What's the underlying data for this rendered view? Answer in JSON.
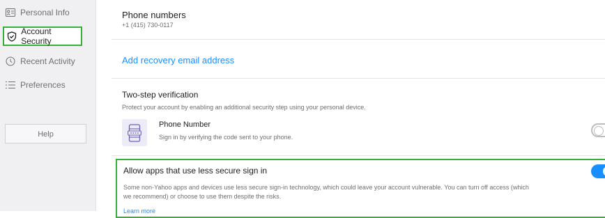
{
  "sidebar": {
    "items": [
      {
        "label": "Personal Info",
        "icon": "id-card-icon"
      },
      {
        "label": "Account Security",
        "icon": "shield-icon"
      },
      {
        "label": "Recent Activity",
        "icon": "clock-icon"
      },
      {
        "label": "Preferences",
        "icon": "list-icon"
      }
    ],
    "active_index": 1,
    "help_label": "Help"
  },
  "main": {
    "phone": {
      "title": "Phone numbers",
      "value": "+1 (415) 730-0117"
    },
    "recovery": {
      "link_label": "Add recovery email address"
    },
    "two_step": {
      "title": "Two-step verification",
      "description": "Protect your account by enabling an additional security step using your personal device.",
      "method": {
        "label": "Phone Number",
        "description": "Sign in by verifying the code sent to your phone.",
        "icon": "phone-code-icon",
        "enabled": false
      }
    },
    "less_secure": {
      "title": "Allow apps that use less secure sign in",
      "description": "Some non-Yahoo apps and devices use less secure sign-in technology, which could leave your account vulnerable. You can turn off access (which we recommend) or choose to use them despite the risks.",
      "learn_more": "Learn more",
      "enabled": true
    }
  },
  "colors": {
    "accent": "#188fff",
    "highlight_border": "#36b037",
    "icon_tile": "#ecebf8"
  }
}
